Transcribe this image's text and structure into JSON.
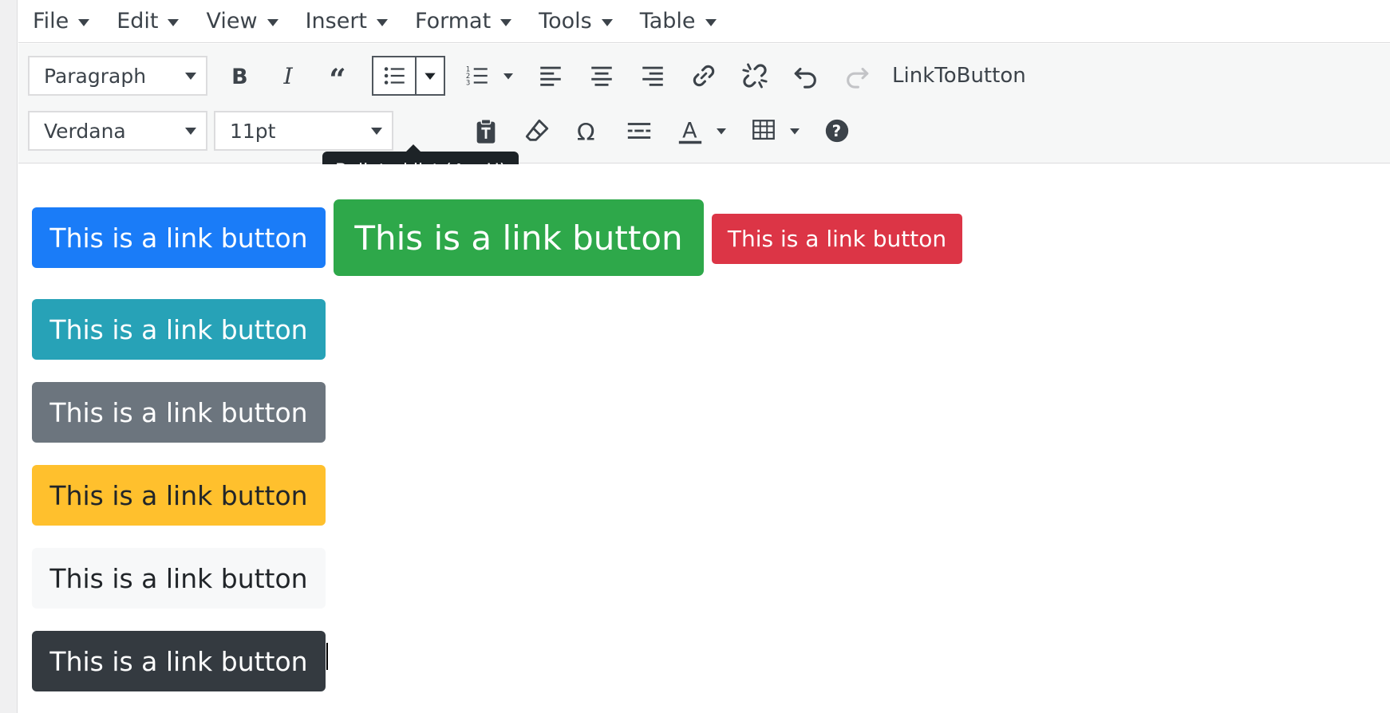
{
  "menubar": {
    "items": [
      {
        "label": "File"
      },
      {
        "label": "Edit"
      },
      {
        "label": "View"
      },
      {
        "label": "Insert"
      },
      {
        "label": "Format"
      },
      {
        "label": "Tools"
      },
      {
        "label": "Table"
      }
    ]
  },
  "toolbar": {
    "block_format": "Paragraph",
    "font_family": "Verdana",
    "font_size": "11pt",
    "link_to_button": "LinkToButton",
    "tooltip": "Bulleted list (^⌥U)",
    "icons": [
      "bold-icon",
      "italic-icon",
      "blockquote-icon",
      "bulleted-list-icon",
      "numbered-list-icon",
      "align-left-icon",
      "align-center-icon",
      "align-right-icon",
      "link-icon",
      "unlink-icon",
      "undo-icon",
      "redo-icon",
      "paste-text-icon",
      "clear-format-icon",
      "special-character-icon",
      "horizontal-line-icon",
      "text-color-icon",
      "table-icon",
      "help-icon"
    ]
  },
  "content": {
    "buttons": [
      {
        "label": "This is a link button",
        "color": "#1a7cf8",
        "text_color": "#ffffff"
      },
      {
        "label": "This is a link button",
        "color": "#2ea84a",
        "text_color": "#ffffff"
      },
      {
        "label": "This is a link button",
        "color": "#dc3546",
        "text_color": "#ffffff"
      },
      {
        "label": "This is a link button",
        "color": "#27a2b7",
        "text_color": "#ffffff"
      },
      {
        "label": "This is a link button",
        "color": "#6c757e",
        "text_color": "#ffffff"
      },
      {
        "label": "This is a link button",
        "color": "#ffc02d",
        "text_color": "#212529"
      },
      {
        "label": "This is a link button",
        "color": "#f7f8f9",
        "text_color": "#212529"
      },
      {
        "label": "This is a link button",
        "color": "#343a40",
        "text_color": "#ffffff"
      }
    ]
  }
}
